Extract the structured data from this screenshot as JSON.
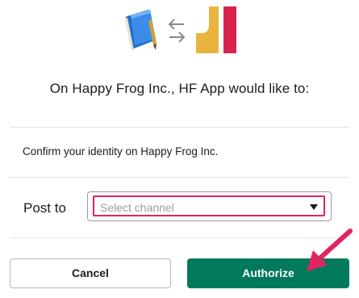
{
  "header": {
    "left_icon": "book-icon",
    "middle_icon": "swap-arrows-icon",
    "right_icon": "hf-app-logo-icon"
  },
  "title": "On Happy Frog Inc., HF App would like to:",
  "permissions": [
    "Confirm your identity on Happy Frog Inc."
  ],
  "post": {
    "label": "Post to",
    "placeholder": "Select channel"
  },
  "buttons": {
    "cancel": "Cancel",
    "authorize": "Authorize"
  },
  "colors": {
    "authorize_bg": "#007a5a",
    "highlight": "#e0245e",
    "app_logo_yellow": "#e8b43f",
    "app_logo_red": "#d8234f"
  }
}
